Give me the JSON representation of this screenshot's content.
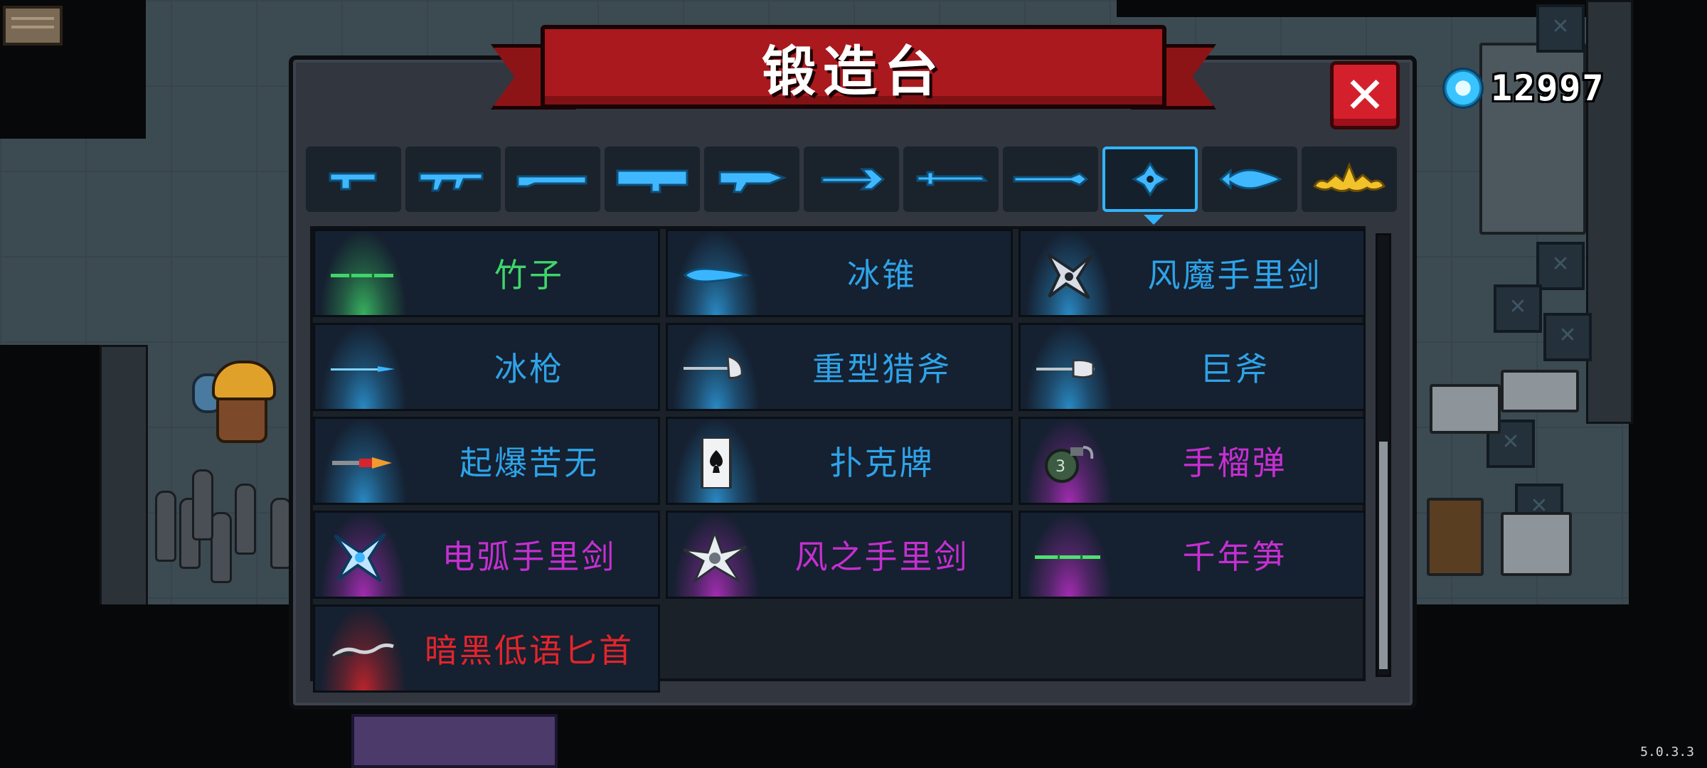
{
  "title": "锻造台",
  "currency": {
    "icon": "blue-gem-icon",
    "value": "12997"
  },
  "close": {
    "icon": "close-x-icon",
    "label": "✕"
  },
  "version": "5.0.3.3",
  "tabs": [
    {
      "name": "pistol-icon",
      "active": false
    },
    {
      "name": "assault-rifle-icon",
      "active": false
    },
    {
      "name": "shotgun-icon",
      "active": false
    },
    {
      "name": "rocket-launcher-icon",
      "active": false
    },
    {
      "name": "laser-gun-icon",
      "active": false
    },
    {
      "name": "bow-icon",
      "active": false
    },
    {
      "name": "sword-icon",
      "active": false
    },
    {
      "name": "spear-icon",
      "active": false
    },
    {
      "name": "throwable-icon",
      "active": true
    },
    {
      "name": "fish-icon",
      "active": false
    },
    {
      "name": "crown-icon",
      "active": false
    }
  ],
  "colors": {
    "green": "#3fd56a",
    "blue": "#2ea3e8",
    "purple": "#c52fd1",
    "red": "#e3252b",
    "accent": "#31b4ff"
  },
  "items": [
    {
      "label": "竹子",
      "icon": "bamboo-icon",
      "rarity": "green"
    },
    {
      "label": "冰锥",
      "icon": "ice-cone-icon",
      "rarity": "blue"
    },
    {
      "label": "风魔手里剑",
      "icon": "fuma-shuriken-icon",
      "rarity": "blue"
    },
    {
      "label": "冰枪",
      "icon": "ice-spear-icon",
      "rarity": "blue"
    },
    {
      "label": "重型猎斧",
      "icon": "heavy-axe-icon",
      "rarity": "blue"
    },
    {
      "label": "巨斧",
      "icon": "giant-axe-icon",
      "rarity": "blue"
    },
    {
      "label": "起爆苦无",
      "icon": "explosive-kunai-icon",
      "rarity": "blue"
    },
    {
      "label": "扑克牌",
      "icon": "poker-card-icon",
      "rarity": "blue"
    },
    {
      "label": "手榴弹",
      "icon": "grenade-icon",
      "rarity": "purple"
    },
    {
      "label": "电弧手里剑",
      "icon": "arc-shuriken-icon",
      "rarity": "purple"
    },
    {
      "label": "风之手里剑",
      "icon": "wind-shuriken-icon",
      "rarity": "purple"
    },
    {
      "label": "千年笋",
      "icon": "bamboo-shoot-icon",
      "rarity": "purple"
    },
    {
      "label": "暗黑低语匕首",
      "icon": "dark-whisper-dagger-icon",
      "rarity": "red"
    }
  ]
}
